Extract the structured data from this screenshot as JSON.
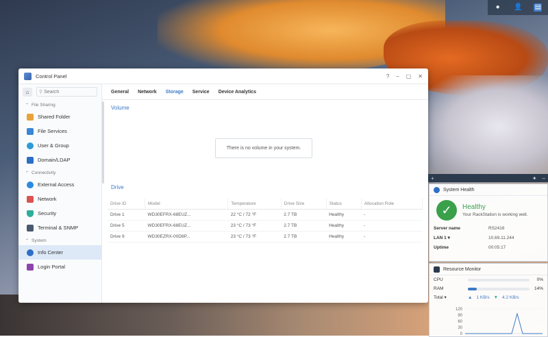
{
  "window": {
    "title": "Control Panel",
    "controls": [
      "?",
      "–",
      "▢",
      "✕"
    ]
  },
  "sidebar": {
    "search_placeholder": "Search",
    "sections": [
      {
        "label": "File Sharing",
        "items": [
          {
            "label": "Shared Folder",
            "color": "#e9a23b"
          },
          {
            "label": "File Services",
            "color": "#3b86d6"
          },
          {
            "label": "User & Group",
            "color": "#2f9bd6"
          },
          {
            "label": "Domain/LDAP",
            "color": "#2d6fc4"
          }
        ]
      },
      {
        "label": "Connectivity",
        "items": [
          {
            "label": "External Access",
            "color": "#2d8ae0"
          },
          {
            "label": "Network",
            "color": "#d9534f"
          },
          {
            "label": "Security",
            "color": "#2cae9a"
          },
          {
            "label": "Terminal & SNMP",
            "color": "#4a5a6e"
          }
        ]
      },
      {
        "label": "System",
        "items": [
          {
            "label": "Info Center",
            "color": "#2d6fc4",
            "selected": true
          },
          {
            "label": "Login Portal",
            "color": "#8e44ad"
          }
        ]
      }
    ]
  },
  "tabs": [
    "General",
    "Network",
    "Storage",
    "Service",
    "Device Analytics"
  ],
  "active_tab": "Storage",
  "volume": {
    "title": "Volume",
    "empty_message": "There is no volume in your system."
  },
  "drive": {
    "title": "Drive",
    "columns": [
      "Drive ID",
      "Model",
      "Temperature",
      "Drive Size",
      "Status",
      "Allocation Role"
    ],
    "rows": [
      [
        "Drive 1",
        "WD30EFRX-68EUZ...",
        "22 °C / 72 °F",
        "2.7 TB",
        "Healthy",
        "-"
      ],
      [
        "Drive 5",
        "WD30EFRX-68EUZ...",
        "23 °C / 73 °F",
        "2.7 TB",
        "Healthy",
        "-"
      ],
      [
        "Drive 9",
        "WD30EZRX-00D8P...",
        "23 °C / 73 °F",
        "2.7 TB",
        "Healthy",
        "-"
      ]
    ]
  },
  "health_widget": {
    "title": "System Health",
    "status": "Healthy",
    "message": "Your RackStation is working well.",
    "rows": [
      {
        "k": "Server name",
        "v": "RS2416"
      },
      {
        "k": "LAN 1 ▾",
        "v": "10.69.11.244"
      },
      {
        "k": "Uptime",
        "v": "00:05:17"
      }
    ]
  },
  "resource_widget": {
    "title": "Resource Monitor",
    "cpu_label": "CPU",
    "cpu_value": "0%",
    "cpu_fraction": 0,
    "ram_label": "RAM",
    "ram_value": "14%",
    "ram_fraction": 0.14,
    "total_label": "Total ▾",
    "upload": "1 KB/s",
    "download": "4.2 KB/s",
    "chart_ticks": [
      "120",
      "90",
      "60",
      "30",
      "0"
    ]
  },
  "colors": {
    "accent": "#3b79c6",
    "healthy": "#3aa04a"
  }
}
